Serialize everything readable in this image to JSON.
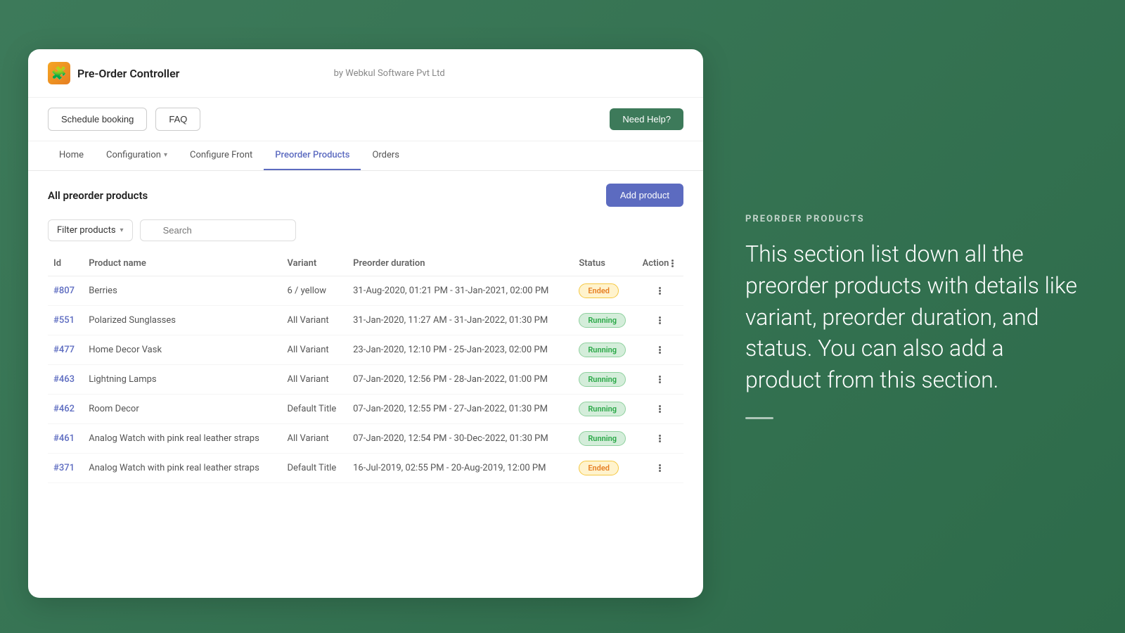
{
  "header": {
    "app_icon": "🧩",
    "app_title": "Pre-Order Controller",
    "by_text": "by Webkul Software Pvt Ltd",
    "schedule_booking_label": "Schedule booking",
    "faq_label": "FAQ",
    "need_help_label": "Need Help?"
  },
  "nav": {
    "items": [
      {
        "label": "Home",
        "active": false
      },
      {
        "label": "Configuration",
        "active": false,
        "has_chevron": true
      },
      {
        "label": "Configure Front",
        "active": false
      },
      {
        "label": "Preorder Products",
        "active": true
      },
      {
        "label": "Orders",
        "active": false
      }
    ]
  },
  "page": {
    "title": "All preorder products",
    "add_product_label": "Add product",
    "filter_label": "Filter products",
    "search_placeholder": "Search"
  },
  "table": {
    "columns": [
      "Id",
      "Product name",
      "Variant",
      "Preorder duration",
      "Status",
      "Action"
    ],
    "rows": [
      {
        "id": "#807",
        "product_name": "Berries",
        "variant": "6 / yellow",
        "preorder_duration": "31-Aug-2020, 01:21 PM - 31-Jan-2021, 02:00 PM",
        "status": "Ended",
        "status_type": "ended"
      },
      {
        "id": "#551",
        "product_name": "Polarized Sunglasses",
        "variant": "All Variant",
        "preorder_duration": "31-Jan-2020, 11:27 AM - 31-Jan-2022, 01:30 PM",
        "status": "Running",
        "status_type": "running"
      },
      {
        "id": "#477",
        "product_name": "Home Decor Vask",
        "variant": "All Variant",
        "preorder_duration": "23-Jan-2020, 12:10 PM - 25-Jan-2023, 02:00 PM",
        "status": "Running",
        "status_type": "running"
      },
      {
        "id": "#463",
        "product_name": "Lightning Lamps",
        "variant": "All Variant",
        "preorder_duration": "07-Jan-2020, 12:56 PM - 28-Jan-2022, 01:00 PM",
        "status": "Running",
        "status_type": "running"
      },
      {
        "id": "#462",
        "product_name": "Room Decor",
        "variant": "Default Title",
        "preorder_duration": "07-Jan-2020, 12:55 PM - 27-Jan-2022, 01:30 PM",
        "status": "Running",
        "status_type": "running"
      },
      {
        "id": "#461",
        "product_name": "Analog Watch with pink real leather straps",
        "variant": "All Variant",
        "preorder_duration": "07-Jan-2020, 12:54 PM - 30-Dec-2022, 01:30 PM",
        "status": "Running",
        "status_type": "running"
      },
      {
        "id": "#371",
        "product_name": "Analog Watch with pink real leather straps",
        "variant": "Default Title",
        "preorder_duration": "16-Jul-2019, 02:55 PM - 20-Aug-2019, 12:00 PM",
        "status": "Ended",
        "status_type": "ended"
      }
    ]
  },
  "right_panel": {
    "section_label": "PREORDER PRODUCTS",
    "description": "This section list down all the preorder products with details like variant, preorder duration, and status. You can also add a product from this section."
  }
}
